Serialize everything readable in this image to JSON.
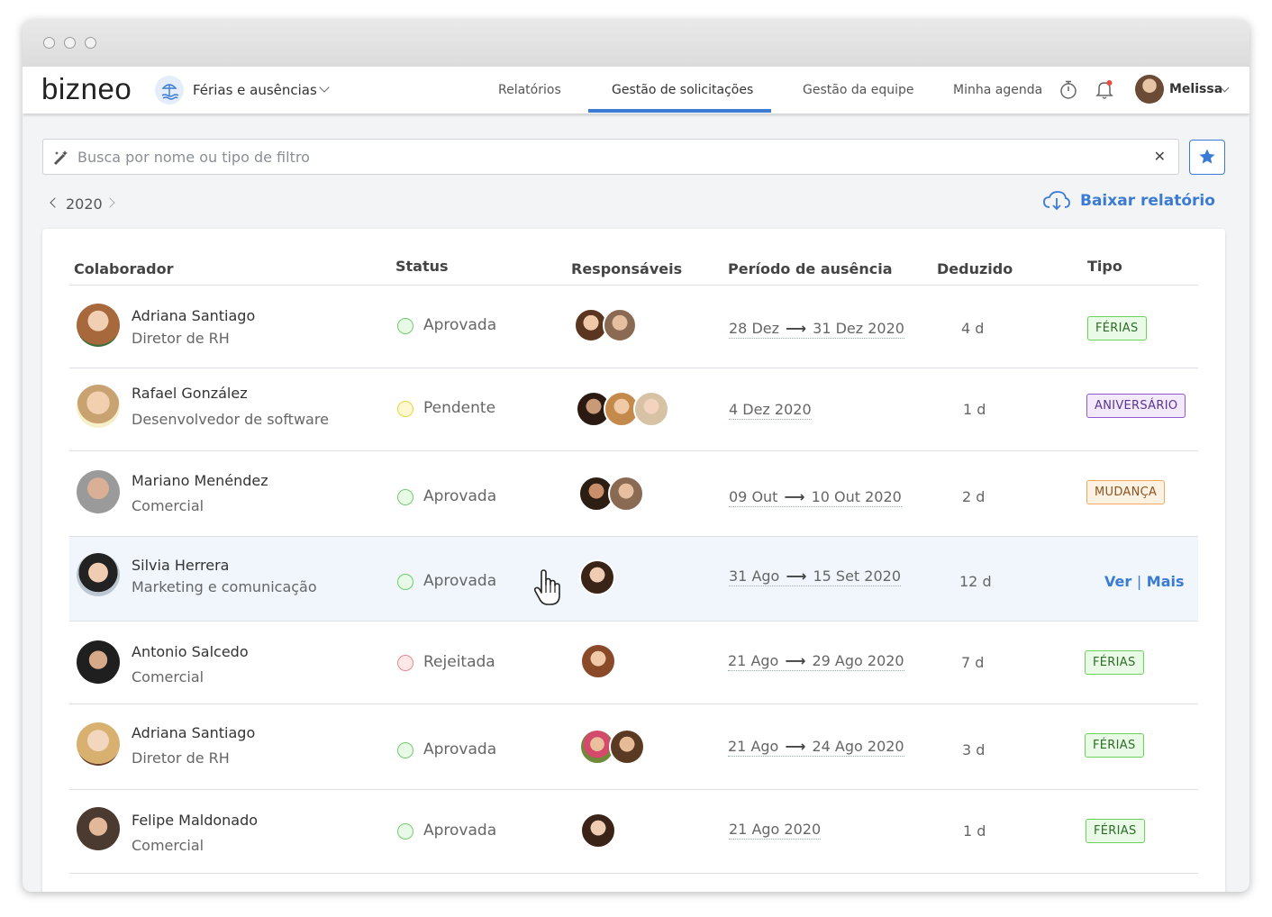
{
  "app": {
    "logo": "bizneo",
    "module": "Férias e ausências"
  },
  "nav": {
    "links": [
      "Relatórios",
      "Gestão de solicitações",
      "Gestão da equipe",
      "Minha agenda"
    ],
    "active_index": 1,
    "user": "Melissa"
  },
  "search": {
    "placeholder": "Busca por nome ou tipo de filtro"
  },
  "year": "2020",
  "download_label": "Baixar relatório",
  "table": {
    "headers": {
      "colaborador": "Colaborador",
      "status": "Status",
      "responsaveis": "Responsáveis",
      "periodo": "Período de ausência",
      "deduzido": "Deduzido",
      "tipo": "Tipo"
    },
    "rows": [
      {
        "name": "Adriana Santiago",
        "role": "Diretor de RH",
        "status": "Aprovada",
        "period_start": "28 Dez",
        "period_end": "31 Dez 2020",
        "deducted": "4 d",
        "type": "FÉRIAS"
      },
      {
        "name": "Rafael González",
        "role": "Desenvolvedor de software",
        "status": "Pendente",
        "period_start": "4 Dez 2020",
        "period_end": "",
        "deducted": "1 d",
        "type": "ANIVERSÁRIO"
      },
      {
        "name": "Mariano Menéndez",
        "role": "Comercial",
        "status": "Aprovada",
        "period_start": "09 Out",
        "period_end": "10 Out 2020",
        "deducted": "2 d",
        "type": "MUDANÇA"
      },
      {
        "name": "Silvia Herrera",
        "role": "Marketing e comunicação",
        "status": "Aprovada",
        "period_start": "31 Ago",
        "period_end": "15 Set 2020",
        "deducted": "12 d",
        "type": "",
        "link_view": "Ver",
        "link_sep": "|",
        "link_more": "Mais"
      },
      {
        "name": "Antonio Salcedo",
        "role": "Comercial",
        "status": "Rejeitada",
        "period_start": "21 Ago",
        "period_end": "29 Ago 2020",
        "deducted": "7 d",
        "type": "FÉRIAS"
      },
      {
        "name": "Adriana Santiago",
        "role": "Diretor de RH",
        "status": "Aprovada",
        "period_start": "21 Ago",
        "period_end": "24 Ago 2020",
        "deducted": "3 d",
        "type": "FÉRIAS"
      },
      {
        "name": "Felipe Maldonado",
        "role": "Comercial",
        "status": "Aprovada",
        "period_start": "21 Ago 2020",
        "period_end": "",
        "deducted": "1 d",
        "type": "FÉRIAS"
      }
    ]
  },
  "colors": {
    "accent": "#3b7bd4",
    "approved": "#6fcf6a",
    "pending": "#e8d64a",
    "rejected": "#e88a8a"
  }
}
